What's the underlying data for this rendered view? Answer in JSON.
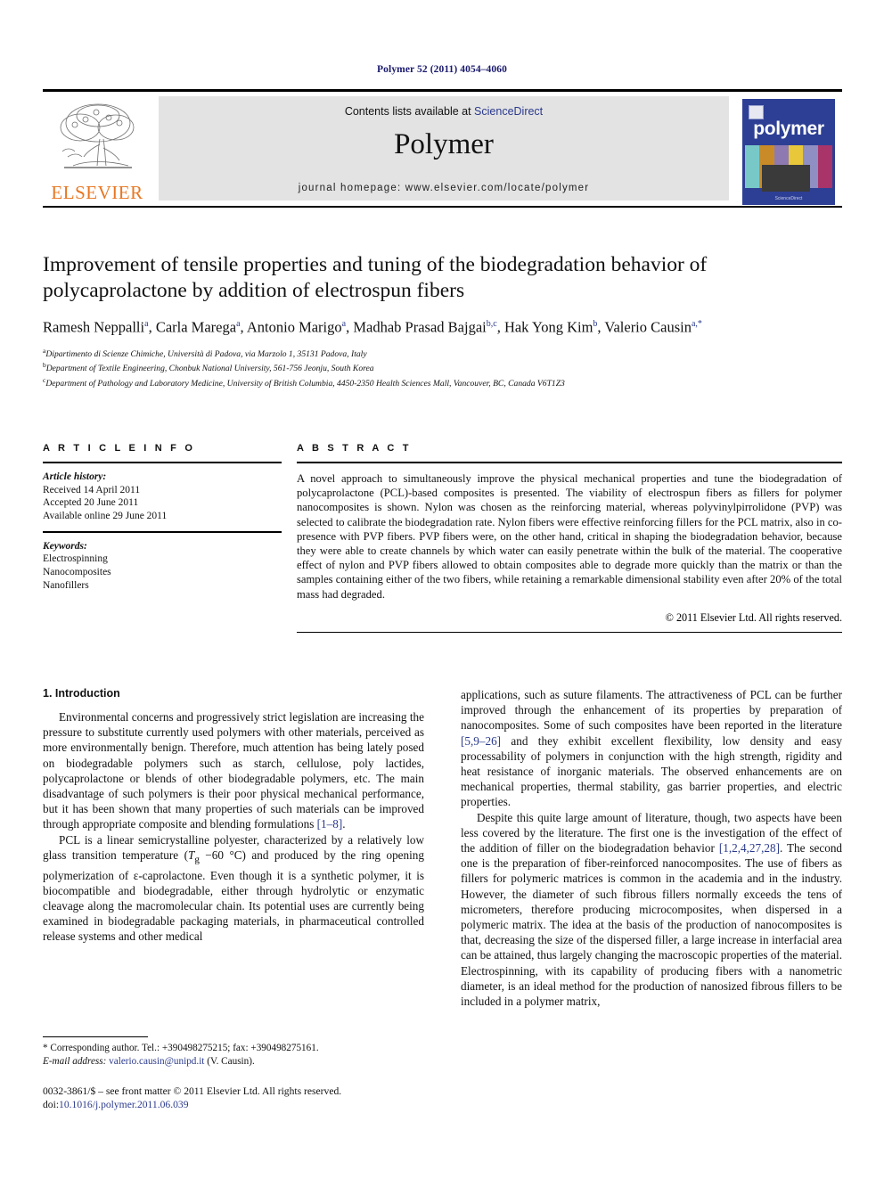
{
  "running_head": "Polymer 52 (2011) 4054–4060",
  "masthead": {
    "publisher_name": "ELSEVIER",
    "contents_prefix": "Contents lists available at ",
    "contents_link": "ScienceDirect",
    "journal_title": "Polymer",
    "homepage": "journal homepage: www.elsevier.com/locate/polymer",
    "cover_word": "polymer",
    "cover_footer": "ScienceDirect",
    "colors": {
      "elsevier_orange": "#e87722",
      "link_blue": "#2b3a8c",
      "band_gray": "#e3e3e3",
      "cover_blue": "#2d3f95"
    }
  },
  "article": {
    "title": "Improvement of tensile properties and tuning of the biodegradation behavior of polycaprolactone by addition of electrospun fibers",
    "authors_html": "Ramesh Neppalli<sup>a</sup>, Carla Marega<sup>a</sup>, Antonio Marigo<sup>a</sup>, Madhab Prasad Bajgai<sup>b,c</sup>, Hak Yong Kim<sup>b</sup>, Valerio Causin<sup>a,*</sup>",
    "affiliations": [
      {
        "marker": "a",
        "text": "Dipartimento di Scienze Chimiche, Università di Padova, via Marzolo 1, 35131 Padova, Italy"
      },
      {
        "marker": "b",
        "text": "Department of Textile Engineering, Chonbuk National University, 561-756 Jeonju, South Korea"
      },
      {
        "marker": "c",
        "text": "Department of Pathology and Laboratory Medicine, University of British Columbia, 4450-2350 Health Sciences Mall, Vancouver, BC, Canada V6T1Z3"
      }
    ]
  },
  "article_info": {
    "heading": "A R T I C L E  I N F O",
    "history_label": "Article history:",
    "history": [
      "Received 14 April 2011",
      "Accepted 20 June 2011",
      "Available online 29 June 2011"
    ],
    "keywords_label": "Keywords:",
    "keywords": [
      "Electrospinning",
      "Nanocomposites",
      "Nanofillers"
    ]
  },
  "abstract": {
    "heading": "A B S T R A C T",
    "text": "A novel approach to simultaneously improve the physical mechanical properties and tune the biodegradation of polycaprolactone (PCL)-based composites is presented. The viability of electrospun fibers as fillers for polymer nanocomposites is shown. Nylon was chosen as the reinforcing material, whereas polyvinylpirrolidone (PVP) was selected to calibrate the biodegradation rate. Nylon fibers were effective reinforcing fillers for the PCL matrix, also in co-presence with PVP fibers. PVP fibers were, on the other hand, critical in shaping the biodegradation behavior, because they were able to create channels by which water can easily penetrate within the bulk of the material. The cooperative effect of nylon and PVP fibers allowed to obtain composites able to degrade more quickly than the matrix or than the samples containing either of the two fibers, while retaining a remarkable dimensional stability even after 20% of the total mass had degraded.",
    "copyright": "© 2011 Elsevier Ltd. All rights reserved."
  },
  "body": {
    "section_number_title": "1. Introduction",
    "left_paragraph_1_html": "Environmental concerns and progressively strict legislation are increasing the pressure to substitute currently used polymers with other materials, perceived as more environmentally benign. Therefore, much attention has being lately posed on biodegradable polymers such as starch, cellulose, poly lactides, polycaprolactone or blends of other biodegradable polymers, etc. The main disadvantage of such polymers is their poor physical mechanical performance, but it has been shown that many properties of such materials can be improved through appropriate composite and blending formulations <span class=\"ref\">[1–8]</span>.",
    "left_paragraph_2_html": "PCL is a linear semicrystalline polyester, characterized by a relatively low glass transition temperature (<i>T</i><sub>g</sub> −60 °C) and produced by the ring opening polymerization of ε-caprolactone. Even though it is a synthetic polymer, it is biocompatible and biodegradable, either through hydrolytic or enzymatic cleavage along the macromolecular chain. Its potential uses are currently being examined in biodegradable packaging materials, in pharmaceutical controlled release systems and other medical",
    "right_paragraph_1_html": "applications, such as suture filaments. The attractiveness of PCL can be further improved through the enhancement of its properties by preparation of nanocomposites. Some of such composites have been reported in the literature <span class=\"ref\">[5,9–26]</span> and they exhibit excellent flexibility, low density and easy processability of polymers in conjunction with the high strength, rigidity and heat resistance of inorganic materials. The observed enhancements are on mechanical properties, thermal stability, gas barrier properties, and electric properties.",
    "right_paragraph_2_html": "Despite this quite large amount of literature, though, two aspects have been less covered by the literature. The first one is the investigation of the effect of the addition of filler on the biodegradation behavior <span class=\"ref\">[1,2,4,27,28]</span>. The second one is the preparation of fiber-reinforced nanocomposites. The use of fibers as fillers for polymeric matrices is common in the academia and in the industry. However, the diameter of such fibrous fillers normally exceeds the tens of micrometers, therefore producing microcomposites, when dispersed in a polymeric matrix. The idea at the basis of the production of nanocomposites is that, decreasing the size of the dispersed filler, a large increase in interfacial area can be attained, thus largely changing the macroscopic properties of the material. Electrospinning, with its capability of producing fibers with a nanometric diameter, is an ideal method for the production of nanosized fibrous fillers to be included in a polymer matrix,"
  },
  "footnotes": {
    "corresponding_html": "* Corresponding author. Tel.: +390498275215; fax: +390498275161.",
    "email_label": "E-mail address:",
    "email": "valerio.causin@unipd.it",
    "email_suffix": "(V. Causin).",
    "issn_line": "0032-3861/$ – see front matter © 2011 Elsevier Ltd. All rights reserved.",
    "doi_prefix": "doi:",
    "doi": "10.1016/j.polymer.2011.06.039"
  }
}
